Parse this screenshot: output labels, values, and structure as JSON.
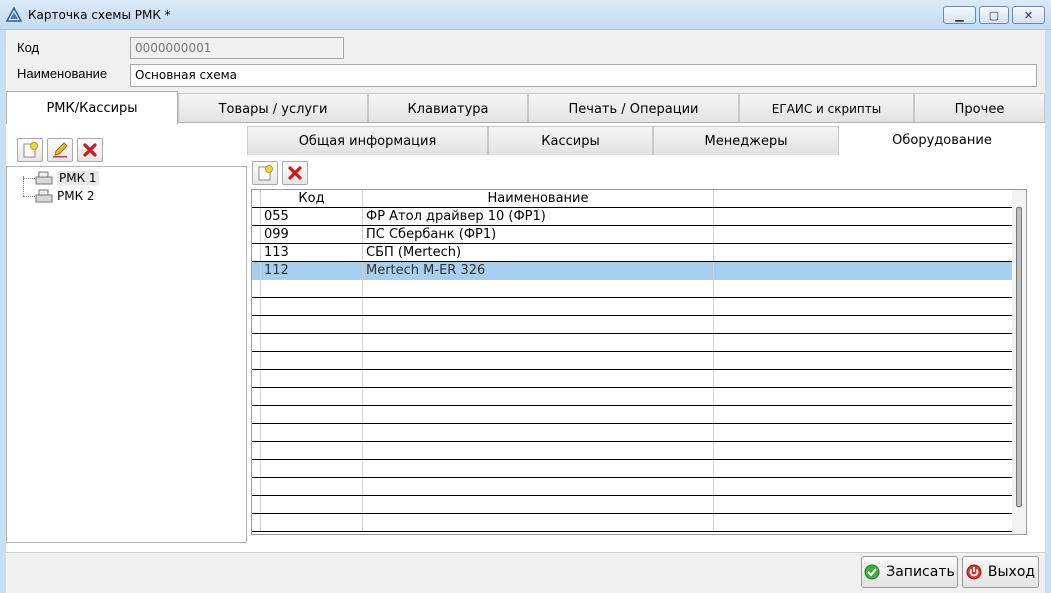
{
  "window": {
    "title": "Карточка схемы РМК *"
  },
  "fields": {
    "code_label": "Код",
    "code_value": "0000000001",
    "name_label": "Наименование",
    "name_value": "Основная схема"
  },
  "tabs": [
    {
      "label": "РМК/Кассиры",
      "active": true
    },
    {
      "label": "Товары / услуги"
    },
    {
      "label": "Клавиатура"
    },
    {
      "label": "Печать / Операции"
    },
    {
      "label": "ЕГАИС и скрипты"
    },
    {
      "label": "Прочее"
    }
  ],
  "tree": {
    "items": [
      {
        "label": "РМК 1",
        "selected": true
      },
      {
        "label": "РМК 2"
      }
    ]
  },
  "subtabs": [
    {
      "label": "Общая информация"
    },
    {
      "label": "Кассиры"
    },
    {
      "label": "Менеджеры"
    },
    {
      "label": "Оборудование",
      "active": true
    }
  ],
  "grid": {
    "headers": [
      "Код",
      "Наименование"
    ],
    "rows": [
      {
        "code": "055",
        "name": "ФР Атол драйвер 10 (ФР1)"
      },
      {
        "code": "099",
        "name": "ПС Сбербанк (ФР1)"
      },
      {
        "code": "113",
        "name": "СБП (Mertech)"
      },
      {
        "code": "112",
        "name": "Mertech M-ER 326",
        "selected": true
      }
    ]
  },
  "buttons": {
    "save": "Записать",
    "exit": "Выход"
  },
  "icons": {
    "add": "new-document-icon",
    "edit": "pencil-icon",
    "delete": "red-x-icon",
    "tree_item": "cash-register-icon",
    "save": "green-check-icon",
    "exit": "red-power-icon"
  },
  "colors": {
    "selected_row": "#a8d0ee",
    "window_frame": "#c9dff3"
  }
}
